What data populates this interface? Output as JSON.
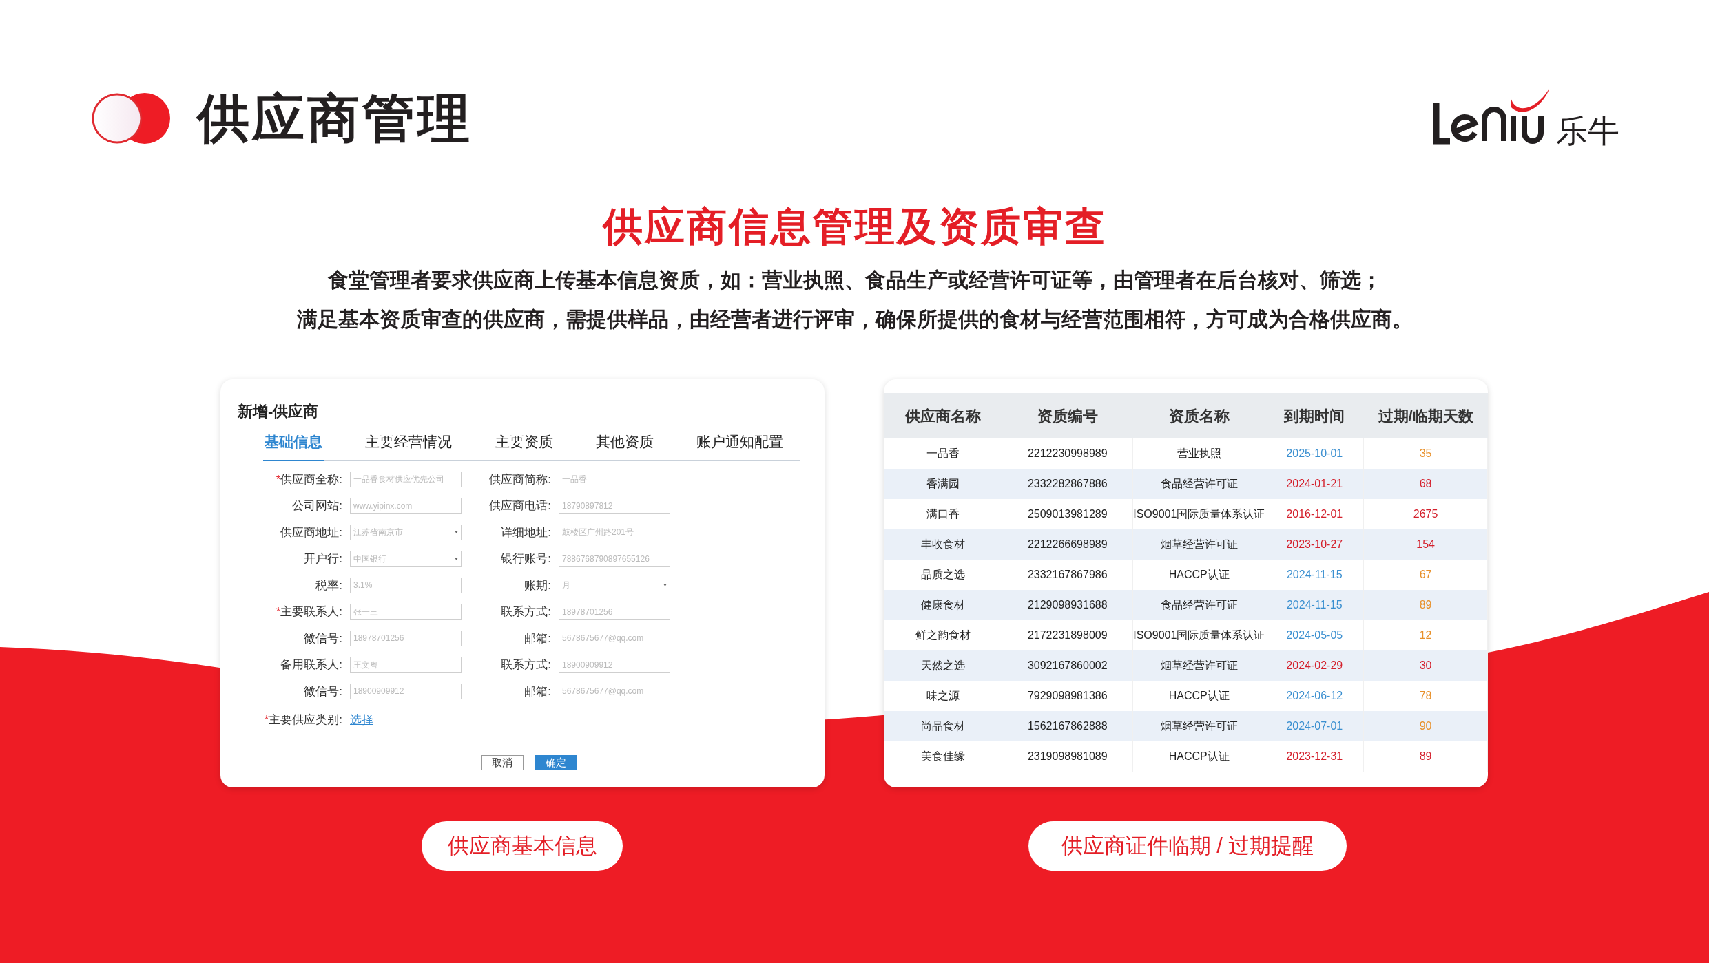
{
  "header": {
    "title": "供应商管理",
    "logo_text": "乐牛"
  },
  "headline": "供应商信息管理及资质审查",
  "description": [
    "食堂管理者要求供应商上传基本信息资质，如：营业执照、食品生产或经营许可证等，由管理者在后台核对、筛选；",
    "满足基本资质审查的供应商，需提供样品，由经营者进行评审，确保所提供的食材与经营范围相符，方可成为合格供应商。"
  ],
  "form": {
    "title": "新增-供应商",
    "tabs": [
      {
        "label": "基础信息",
        "selected": true
      },
      {
        "label": "主要经营情况",
        "selected": false
      },
      {
        "label": "主要资质",
        "selected": false
      },
      {
        "label": "其他资质",
        "selected": false
      },
      {
        "label": "账户通知配置",
        "selected": false
      }
    ],
    "rows": [
      [
        {
          "marker": "*",
          "label": "供应商全称:",
          "value": "一品香食材供应优先公司",
          "kind": "text"
        },
        {
          "label": "供应商简称:",
          "value": "一品香",
          "kind": "text"
        }
      ],
      [
        {
          "label": "公司网站:",
          "value": "www.yipinx.com",
          "kind": "text"
        },
        {
          "label": "供应商电话:",
          "value": "18790897812",
          "kind": "text"
        }
      ],
      [
        {
          "label": "供应商地址:",
          "value": "江苏省南京市",
          "kind": "select"
        },
        {
          "label": "详细地址:",
          "value": "鼓楼区广州路201号",
          "kind": "text"
        }
      ],
      [
        {
          "label": "开户行:",
          "value": "中国银行",
          "kind": "select"
        },
        {
          "label": "银行账号:",
          "value": "7886768790897655126",
          "kind": "text"
        }
      ],
      [
        {
          "label": "税率:",
          "value": "3.1%",
          "kind": "text"
        },
        {
          "label": "账期:",
          "value": "月",
          "kind": "select"
        }
      ],
      [
        {
          "marker": "*",
          "label": "主要联系人:",
          "value": "张一三",
          "kind": "text"
        },
        {
          "label": "联系方式:",
          "value": "18978701256",
          "kind": "text"
        }
      ],
      [
        {
          "label": "微信号:",
          "value": "18978701256",
          "kind": "text"
        },
        {
          "label": "邮箱:",
          "value": "5678675677@qq.com",
          "kind": "text"
        }
      ],
      [
        {
          "label": "备用联系人:",
          "value": "王文粤",
          "kind": "text"
        },
        {
          "label": "联系方式:",
          "value": "18900909912",
          "kind": "text"
        }
      ],
      [
        {
          "label": "微信号:",
          "value": "18900909912",
          "kind": "text"
        },
        {
          "label": "邮箱:",
          "value": "5678675677@qq.com",
          "kind": "text"
        }
      ]
    ],
    "category": {
      "marker": "*",
      "label": "主要供应类别:",
      "link": "选择"
    },
    "buttons": [
      {
        "label": "取消",
        "kind": "secondary"
      },
      {
        "label": "确定",
        "kind": "primary"
      }
    ]
  },
  "table": {
    "columns": [
      "供应商名称",
      "资质编号",
      "资质名称",
      "到期时间",
      "过期/临期天数"
    ],
    "rows": [
      {
        "cells": [
          "一品香",
          "2212230998989",
          "营业执照",
          "2025-10-01",
          "35"
        ],
        "expired": false
      },
      {
        "cells": [
          "香满园",
          "2332282867886",
          "食品经营许可证",
          "2024-01-21",
          "68"
        ],
        "expired": true
      },
      {
        "cells": [
          "满口香",
          "2509013981289",
          "ISO9001国际质量体系认证",
          "2016-12-01",
          "2675"
        ],
        "expired": true
      },
      {
        "cells": [
          "丰收食材",
          "2212266698989",
          "烟草经营许可证",
          "2023-10-27",
          "154"
        ],
        "expired": true
      },
      {
        "cells": [
          "品质之选",
          "2332167867986",
          "HACCP认证",
          "2024-11-15",
          "67"
        ],
        "expired": false
      },
      {
        "cells": [
          "健康食材",
          "2129098931688",
          "食品经营许可证",
          "2024-11-15",
          "89"
        ],
        "expired": false
      },
      {
        "cells": [
          "鲜之韵食材",
          "2172231898009",
          "ISO9001国际质量体系认证",
          "2024-05-05",
          "12"
        ],
        "expired": false
      },
      {
        "cells": [
          "天然之选",
          "3092167860002",
          "烟草经营许可证",
          "2024-02-29",
          "30"
        ],
        "expired": true
      },
      {
        "cells": [
          "味之源",
          "7929098981386",
          "HACCP认证",
          "2024-06-12",
          "78"
        ],
        "expired": false
      },
      {
        "cells": [
          "尚品食材",
          "1562167862888",
          "烟草经营许可证",
          "2024-07-01",
          "90"
        ],
        "expired": false
      },
      {
        "cells": [
          "美食佳缘",
          "2319098981089",
          "HACCP认证",
          "2023-12-31",
          "89"
        ],
        "expired": true
      }
    ]
  },
  "captions": [
    "供应商基本信息",
    "供应商证件临期 / 过期提醒"
  ]
}
